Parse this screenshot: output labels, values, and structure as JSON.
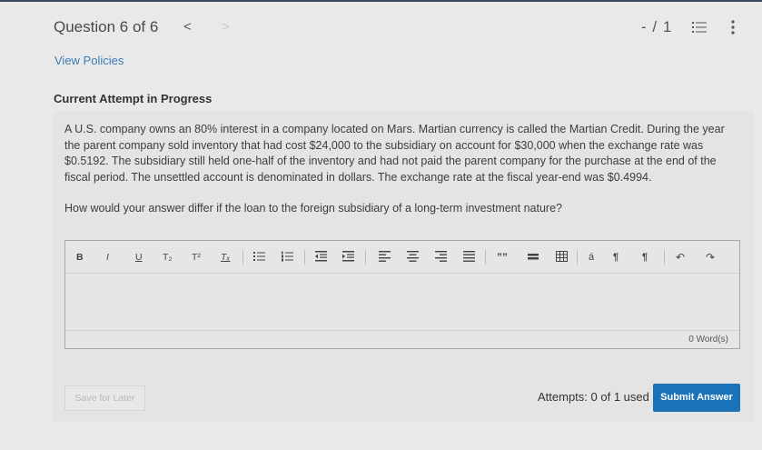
{
  "header": {
    "question_label": "Question 6 of 6",
    "prev_glyph": "<",
    "next_glyph": ">",
    "score": "- / 1",
    "icons": [
      "list-icon",
      "more-vertical-icon"
    ]
  },
  "links": {
    "view_policies": "View Policies"
  },
  "attempt": {
    "label": "Current Attempt in Progress"
  },
  "question": {
    "body": "A U.S. company owns an 80% interest in a company located on Mars. Martian currency is called the Martian Credit. During the year the parent company sold inventory that had cost $24,000 to the subsidiary on account for $30,000 when the exchange rate was $0.5192. The subsidiary still held one-half of the inventory and had not paid the parent company for the purchase at the end of the fiscal period. The unsettled account is denominated in dollars. The exchange rate at the fiscal year-end was $0.4994.",
    "prompt": "How would your answer differ if the loan to the foreign subsidiary of a long-term investment nature?"
  },
  "editor": {
    "toolbar": {
      "bold": "B",
      "italic": "I",
      "underline": "U",
      "subscript": "T₂",
      "superscript": "T²",
      "clear_format": "Tₓ",
      "quote": "””",
      "special_char": "á",
      "ltr": "¶",
      "rtl": "¶",
      "undo": "↶",
      "redo": "↷"
    },
    "value": "",
    "word_count": "0 Word(s)"
  },
  "footer": {
    "save_label": "Save for Later",
    "attempts_text": "Attempts: 0 of 1 used",
    "submit_label": "Submit Answer"
  },
  "colors": {
    "accent": "#1a73b8",
    "link": "#3a7cb8",
    "background": "#e9e9e9"
  }
}
